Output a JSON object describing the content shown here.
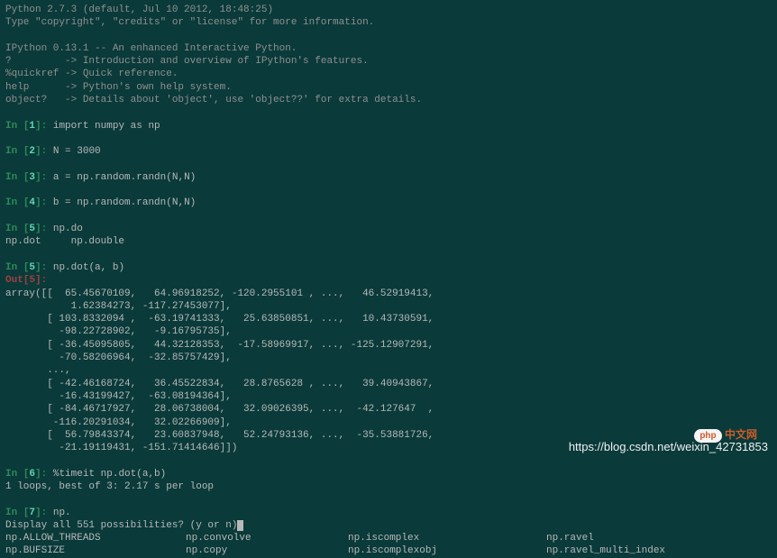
{
  "header": {
    "line1": "Python 2.7.3 (default, Jul 10 2012, 18:48:25)",
    "line2": "Type \"copyright\", \"credits\" or \"license\" for more information.",
    "ipython": "IPython 0.13.1 -- An enhanced Interactive Python.",
    "help1": "?         -> Introduction and overview of IPython's features.",
    "help2": "%quickref -> Quick reference.",
    "help3": "help      -> Python's own help system.",
    "help4": "object?   -> Details about 'object', use 'object??' for extra details."
  },
  "cells": {
    "in1": "import numpy as np",
    "in2": "N = 3000",
    "in3": "a = np.random.randn(N,N)",
    "in4": "b = np.random.randn(N,N)",
    "in5a": "np.do",
    "in5a_comp": "np.dot     np.double",
    "in5b": "np.dot(a, b)",
    "out5": [
      "array([[  65.45670109,   64.96918252, -120.2955101 , ...,   46.52919413,",
      "           1.62384273, -117.27453077],",
      "       [ 103.8332094 ,  -63.19741333,   25.63850851, ...,   10.43730591,",
      "         -98.22728902,   -9.16795735],",
      "       [ -36.45095805,   44.32128353,  -17.58969917, ..., -125.12907291,",
      "         -70.58206964,  -32.85757429],",
      "       ..., ",
      "       [ -42.46168724,   36.45522834,   28.8765628 , ...,   39.40943867,",
      "         -16.43199427,  -63.08194364],",
      "       [ -84.46717927,   28.06738004,   32.09026395, ...,  -42.127647  ,",
      "        -116.20291034,   32.02266909],",
      "       [  56.79843374,   23.60837948,   52.24793136, ...,  -35.53881726,",
      "         -21.19119431, -151.71414646]])"
    ],
    "in6": "%timeit np.dot(a,b)",
    "in6_out": "1 loops, best of 3: 2.17 s per loop",
    "in7": "np.",
    "in7_prompt": "Display all 551 possibilities? (y or n)",
    "completions": {
      "c1a": "np.ALLOW_THREADS",
      "c1b": "np.convolve",
      "c1c": "np.iscomplex",
      "c1d": "np.ravel",
      "c2a": "np.BUFSIZE",
      "c2b": "np.copy",
      "c2c": "np.iscomplexobj",
      "c2d": "np.ravel_multi_index"
    }
  },
  "labels": {
    "in": "In ",
    "out": "Out",
    "n1": "1",
    "n2": "2",
    "n3": "3",
    "n4": "4",
    "n5": "5",
    "n6": "6",
    "n7": "7"
  },
  "watermark": "https://blog.csdn.net/weixin_42731853",
  "php_logo": "php"
}
